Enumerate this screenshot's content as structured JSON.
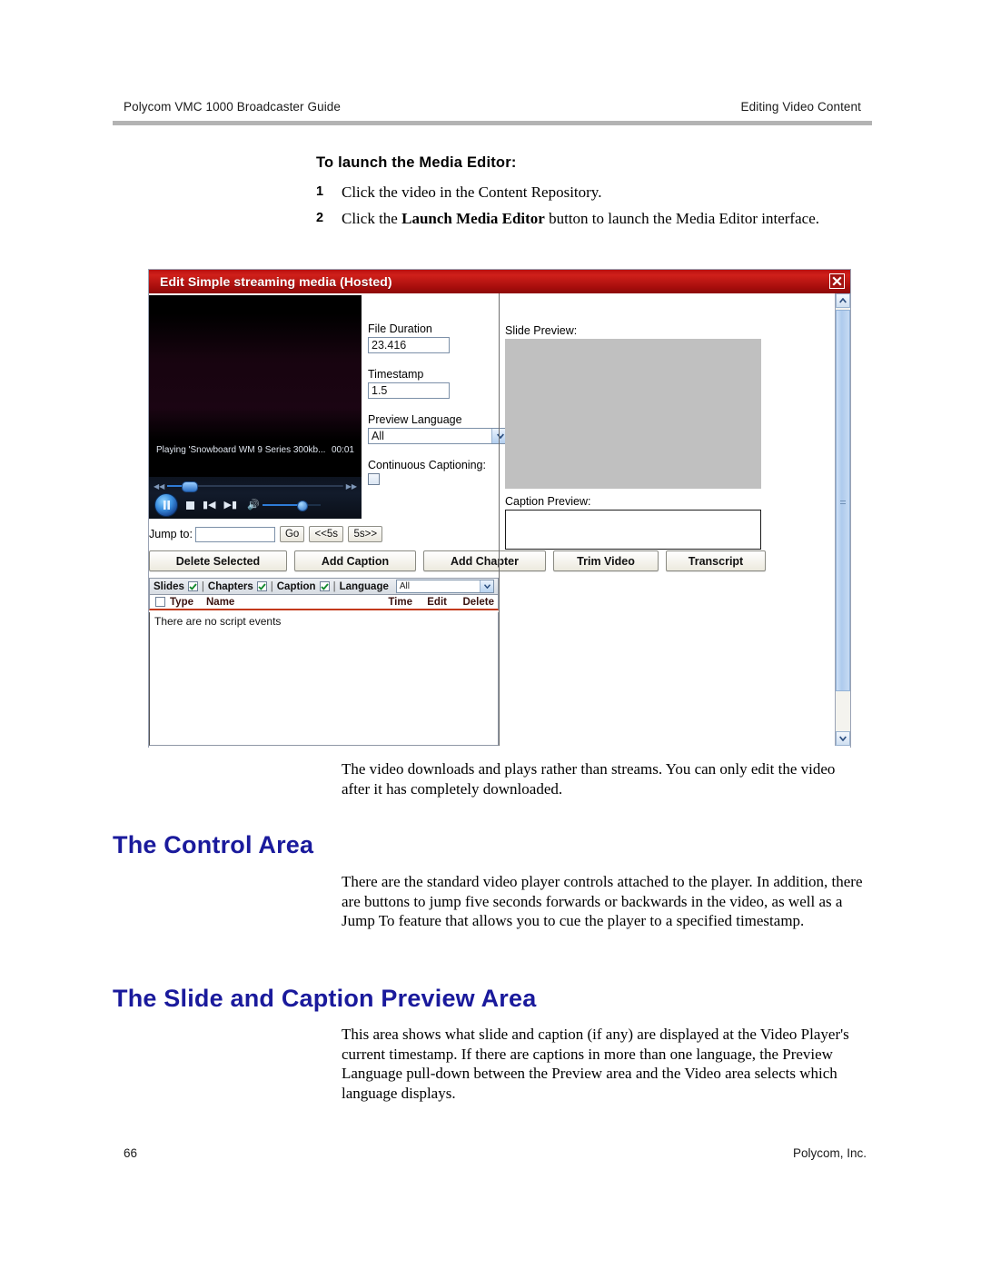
{
  "header": {
    "left": "Polycom VMC 1000 Broadcaster Guide",
    "right": "Editing Video Content"
  },
  "instructions": {
    "heading": "To launch the Media Editor:",
    "steps": [
      {
        "num": "1",
        "text_before": "Click the video in the Content Repository.",
        "bold": "",
        "text_after": ""
      },
      {
        "num": "2",
        "text_before": "Click the ",
        "bold": "Launch Media Editor",
        "text_after": " button to launch the Media Editor interface."
      }
    ]
  },
  "dialog": {
    "title": "Edit Simple streaming media (Hosted)",
    "close_icon": "close-icon",
    "video": {
      "status_text": "Playing 'Snowboard WM 9 Series 300kb...",
      "status_time": "00:01",
      "rewind_icon": "rewind-icon",
      "forward_icon": "fast-forward-icon",
      "play_icon": "pause-icon",
      "stop_icon": "stop-icon",
      "prev_icon": "previous-track-icon",
      "next_icon": "next-track-icon",
      "volume_icon": "volume-icon"
    },
    "jump": {
      "label": "Jump to:",
      "value": "",
      "go_label": "Go",
      "back_label": "<<5s",
      "fwd_label": "5s>>"
    },
    "buttons": [
      {
        "label": "Delete Selected",
        "cls": "b1"
      },
      {
        "label": "Add Caption",
        "cls": "b2"
      },
      {
        "label": "Add Chapter",
        "cls": "b3"
      },
      {
        "label": "Trim Video",
        "cls": "b4"
      },
      {
        "label": "Transcript",
        "cls": "b5"
      }
    ],
    "filter": {
      "slides_label": "Slides",
      "slides_checked": true,
      "sep1": "|",
      "chapters_label": "Chapters",
      "chapters_checked": true,
      "sep2": "|",
      "caption_label": "Caption",
      "caption_checked": true,
      "sep3": "|",
      "language_label": "Language",
      "language_value": "All"
    },
    "table": {
      "columns": [
        "Type",
        "Name",
        "Time",
        "Edit",
        "Delete"
      ],
      "empty_message": "There are no script events",
      "rows": []
    },
    "fields": {
      "file_duration_label": "File Duration",
      "file_duration_value": "23.416",
      "timestamp_label": "Timestamp",
      "timestamp_value": "1.5",
      "preview_language_label": "Preview Language",
      "preview_language_value": "All",
      "continuous_captioning_label": "Continuous Captioning:",
      "continuous_captioning_checked": false
    },
    "preview": {
      "slide_label": "Slide Preview:",
      "caption_label": "Caption Preview:",
      "caption_text": ""
    },
    "scrollbar": {
      "up_icon": "chevron-up-icon",
      "down_icon": "chevron-down-icon"
    }
  },
  "body": {
    "note": "The video downloads and plays rather than streams. You can only edit the video after it has completely downloaded.",
    "section1_title": "The Control Area",
    "section1_text": "There are the standard video player controls attached to the player. In addition, there are buttons to jump five seconds forwards or backwards in the video, as well as a Jump To feature that allows you to cue the player to a specified timestamp.",
    "section2_title": "The Slide and Caption Preview Area",
    "section2_text": "This area shows what slide and caption (if any) are displayed at the Video Player's current timestamp. If there are captions in more than one language, the Preview Language pull-down between the Preview area and the Video area selects which language displays."
  },
  "footer": {
    "page_number": "66",
    "company": "Polycom, Inc."
  },
  "colors": {
    "heading_blue": "#1a1a9c",
    "titlebar_red": "#c0120f",
    "table_rule": "#c33a1b"
  }
}
